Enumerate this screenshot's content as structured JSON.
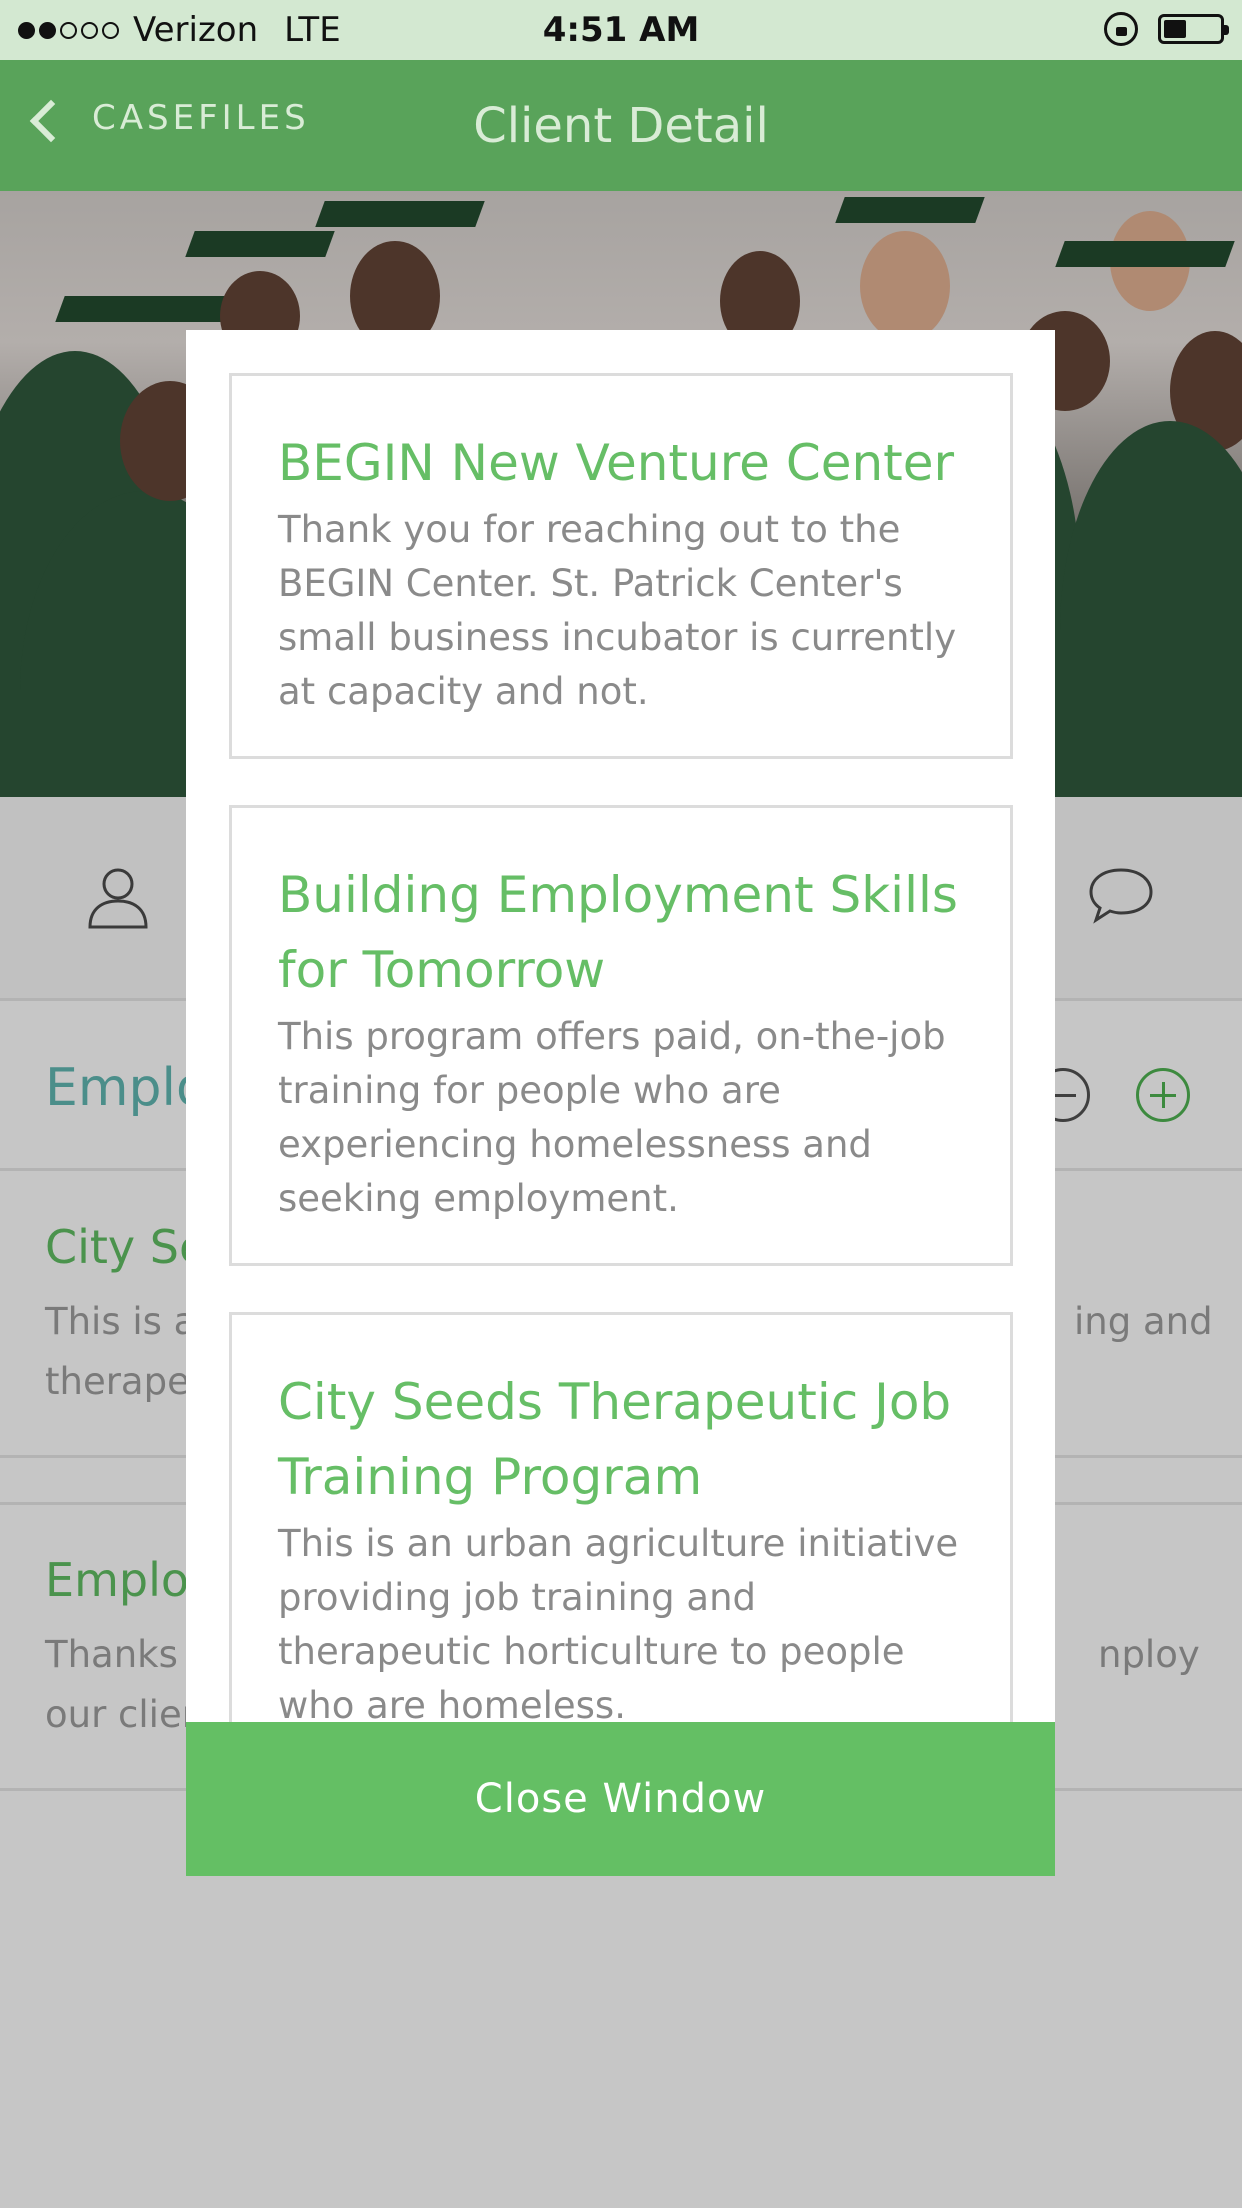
{
  "status_bar": {
    "signal_dots_filled": 2,
    "signal_dots_total": 5,
    "carrier": "Verizon",
    "network": "LTE",
    "time": "4:51 AM",
    "icons": [
      "orientation-lock-icon",
      "battery-icon"
    ],
    "battery_level": 0.3
  },
  "navbar": {
    "back_label": "CASEFILES",
    "title": "Client Detail"
  },
  "background_screen": {
    "tab_icons": [
      "person-icon",
      "chat-bubble-icon"
    ],
    "section_title": "Emplo",
    "card1_title": "City Se",
    "card1_text_left": [
      "This is a",
      "therape"
    ],
    "card1_text_right": "ing and",
    "card2_title": "Employ",
    "card2_text_left": [
      "Thanks",
      "our clier"
    ],
    "card2_text_right": "nploy"
  },
  "modal": {
    "cards": [
      {
        "title": "BEGIN New Venture Center",
        "description": "Thank you for reaching out to the BEGIN Center. St. Patrick Center's small business incubator is currently at capacity and not."
      },
      {
        "title": "Building Employment Skills for Tomorrow",
        "description": "This program offers paid, on-the-job training for people who are experiencing homelessness and seeking employment."
      },
      {
        "title": "City Seeds Therapeutic Job Training Program",
        "description": "This is an urban agriculture initiative providing job training and therapeutic horticulture to people who are homeless."
      }
    ],
    "close_button": "Close Window"
  },
  "colors": {
    "navbar": "#59a35a",
    "accent_green": "#66be66",
    "button_green": "#64bf64",
    "overlay_gray": "#c6c6c6"
  }
}
